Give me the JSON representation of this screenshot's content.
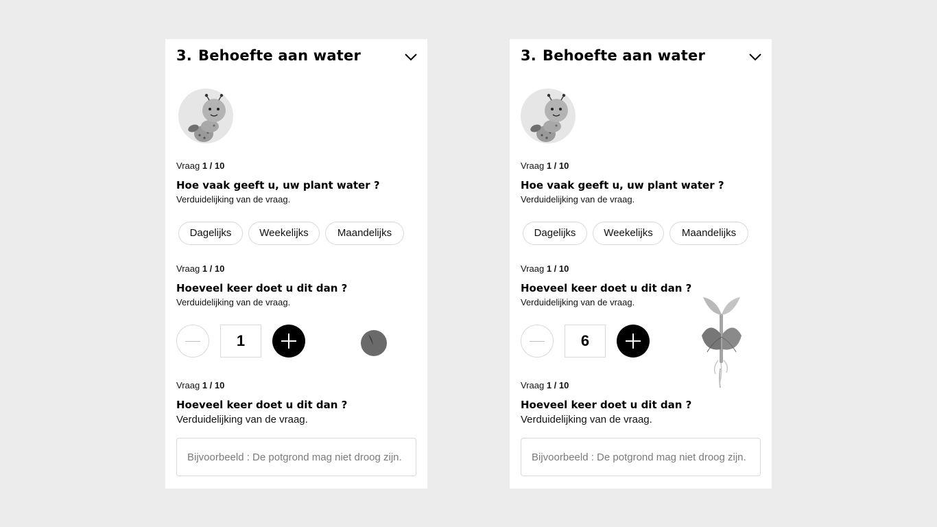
{
  "cards": [
    {
      "section": {
        "number": "3.",
        "title": "Behoefte aan water",
        "toggle_icon": "chevron-down-icon"
      },
      "avatar": {
        "icon": "caterpillar-mascot-icon"
      },
      "question1": {
        "meta_label": "Vraag",
        "meta_count": "1 / 10",
        "title": "Hoe vaak geeft u, uw plant water ?",
        "description": "Verduidelijking van de vraag.",
        "options": [
          "Dagelijks",
          "Weekelijks",
          "Maandelijks"
        ]
      },
      "question2": {
        "meta_label": "Vraag",
        "meta_count": "1 / 10",
        "title": "Hoeveel keer doet u dit dan ?",
        "description": "Verduidelijking van de vraag.",
        "stepper_value": "1",
        "illustration": "seed-icon"
      },
      "question3": {
        "meta_label": "Vraag",
        "meta_count": "1 / 10",
        "title": "Hoeveel keer doet u dit dan ?",
        "description": "Verduidelijking van de vraag.",
        "placeholder": "Bijvoorbeeld : De potgrond mag niet droog zijn."
      }
    },
    {
      "section": {
        "number": "3.",
        "title": "Behoefte aan water",
        "toggle_icon": "chevron-down-icon"
      },
      "avatar": {
        "icon": "caterpillar-mascot-icon"
      },
      "question1": {
        "meta_label": "Vraag",
        "meta_count": "1 / 10",
        "title": "Hoe vaak geeft u, uw plant water ?",
        "description": "Verduidelijking van de vraag.",
        "options": [
          "Dagelijks",
          "Weekelijks",
          "Maandelijks"
        ]
      },
      "question2": {
        "meta_label": "Vraag",
        "meta_count": "1 / 10",
        "title": "Hoeveel keer doet u dit dan ?",
        "description": "Verduidelijking van de vraag.",
        "stepper_value": "6",
        "illustration": "sprouting-plant-icon"
      },
      "question3": {
        "meta_label": "Vraag",
        "meta_count": "1 / 10",
        "title": "Hoeveel keer doet u dit dan ?",
        "description": "Verduidelijking van de vraag.",
        "placeholder": "Bijvoorbeeld : De potgrond mag niet droog zijn."
      }
    }
  ]
}
